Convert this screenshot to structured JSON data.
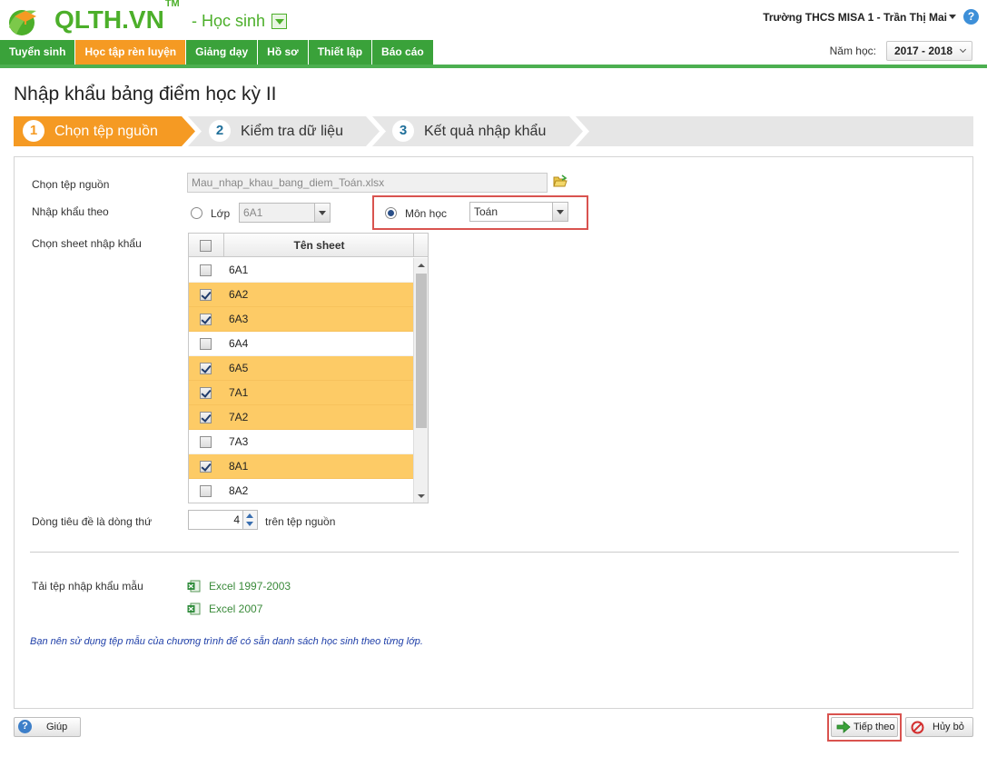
{
  "header": {
    "brand": "QLTH.VN",
    "trademark": "TM",
    "role": "- Học sinh",
    "user": "Trường THCS MISA 1 - Trần Thị Mai",
    "help_glyph": "?"
  },
  "nav": {
    "tabs": [
      {
        "label": "Tuyển sinh",
        "active": false
      },
      {
        "label": "Học tập rèn luyện",
        "active": true
      },
      {
        "label": "Giảng dạy",
        "active": false
      },
      {
        "label": "Hồ sơ",
        "active": false
      },
      {
        "label": "Thiết lập",
        "active": false
      },
      {
        "label": "Báo cáo",
        "active": false
      }
    ],
    "year_label": "Năm học:",
    "year_value": "2017 - 2018"
  },
  "page": {
    "title": "Nhập khẩu bảng điểm học kỳ II"
  },
  "steps": [
    {
      "num": "1",
      "label": "Chọn tệp nguồn",
      "active": true
    },
    {
      "num": "2",
      "label": "Kiểm tra dữ liệu",
      "active": false
    },
    {
      "num": "3",
      "label": "Kết quả nhập khẩu",
      "active": false
    }
  ],
  "form": {
    "source_label": "Chọn tệp nguồn",
    "source_value": "Mau_nhap_khau_bang_diem_Toán.xlsx",
    "import_by_label": "Nhập khẩu theo",
    "class_radio_label": "Lớp",
    "class_value": "6A1",
    "subject_radio_label": "Môn học",
    "subject_value": "Toán",
    "sheet_label": "Chọn sheet nhập khẩu",
    "sheet_header": "Tên sheet",
    "sheets": [
      {
        "name": "6A1",
        "checked": false
      },
      {
        "name": "6A2",
        "checked": true
      },
      {
        "name": "6A3",
        "checked": true
      },
      {
        "name": "6A4",
        "checked": false
      },
      {
        "name": "6A5",
        "checked": true
      },
      {
        "name": "7A1",
        "checked": true
      },
      {
        "name": "7A2",
        "checked": true
      },
      {
        "name": "7A3",
        "checked": false
      },
      {
        "name": "8A1",
        "checked": true
      },
      {
        "name": "8A2",
        "checked": false
      }
    ],
    "header_row_label": "Dòng tiêu đề là dòng thứ",
    "header_row_value": "4",
    "header_row_suffix": "trên tệp nguồn",
    "template_label": "Tải tệp nhập khẩu mẫu",
    "template_links": [
      "Excel 1997-2003",
      "Excel 2007"
    ],
    "note": "Bạn nên sử dụng tệp mẫu của chương trình để có sẵn danh sách học sinh theo từng lớp."
  },
  "buttons": {
    "help": "Giúp",
    "next": "Tiếp theo",
    "cancel": "Hủy bỏ"
  },
  "colors": {
    "brand_green": "#4caf2a",
    "nav_green": "#3aa23a",
    "accent_orange": "#f59a23",
    "selected_row": "#fdcb66",
    "highlight_red": "#d9534f"
  }
}
